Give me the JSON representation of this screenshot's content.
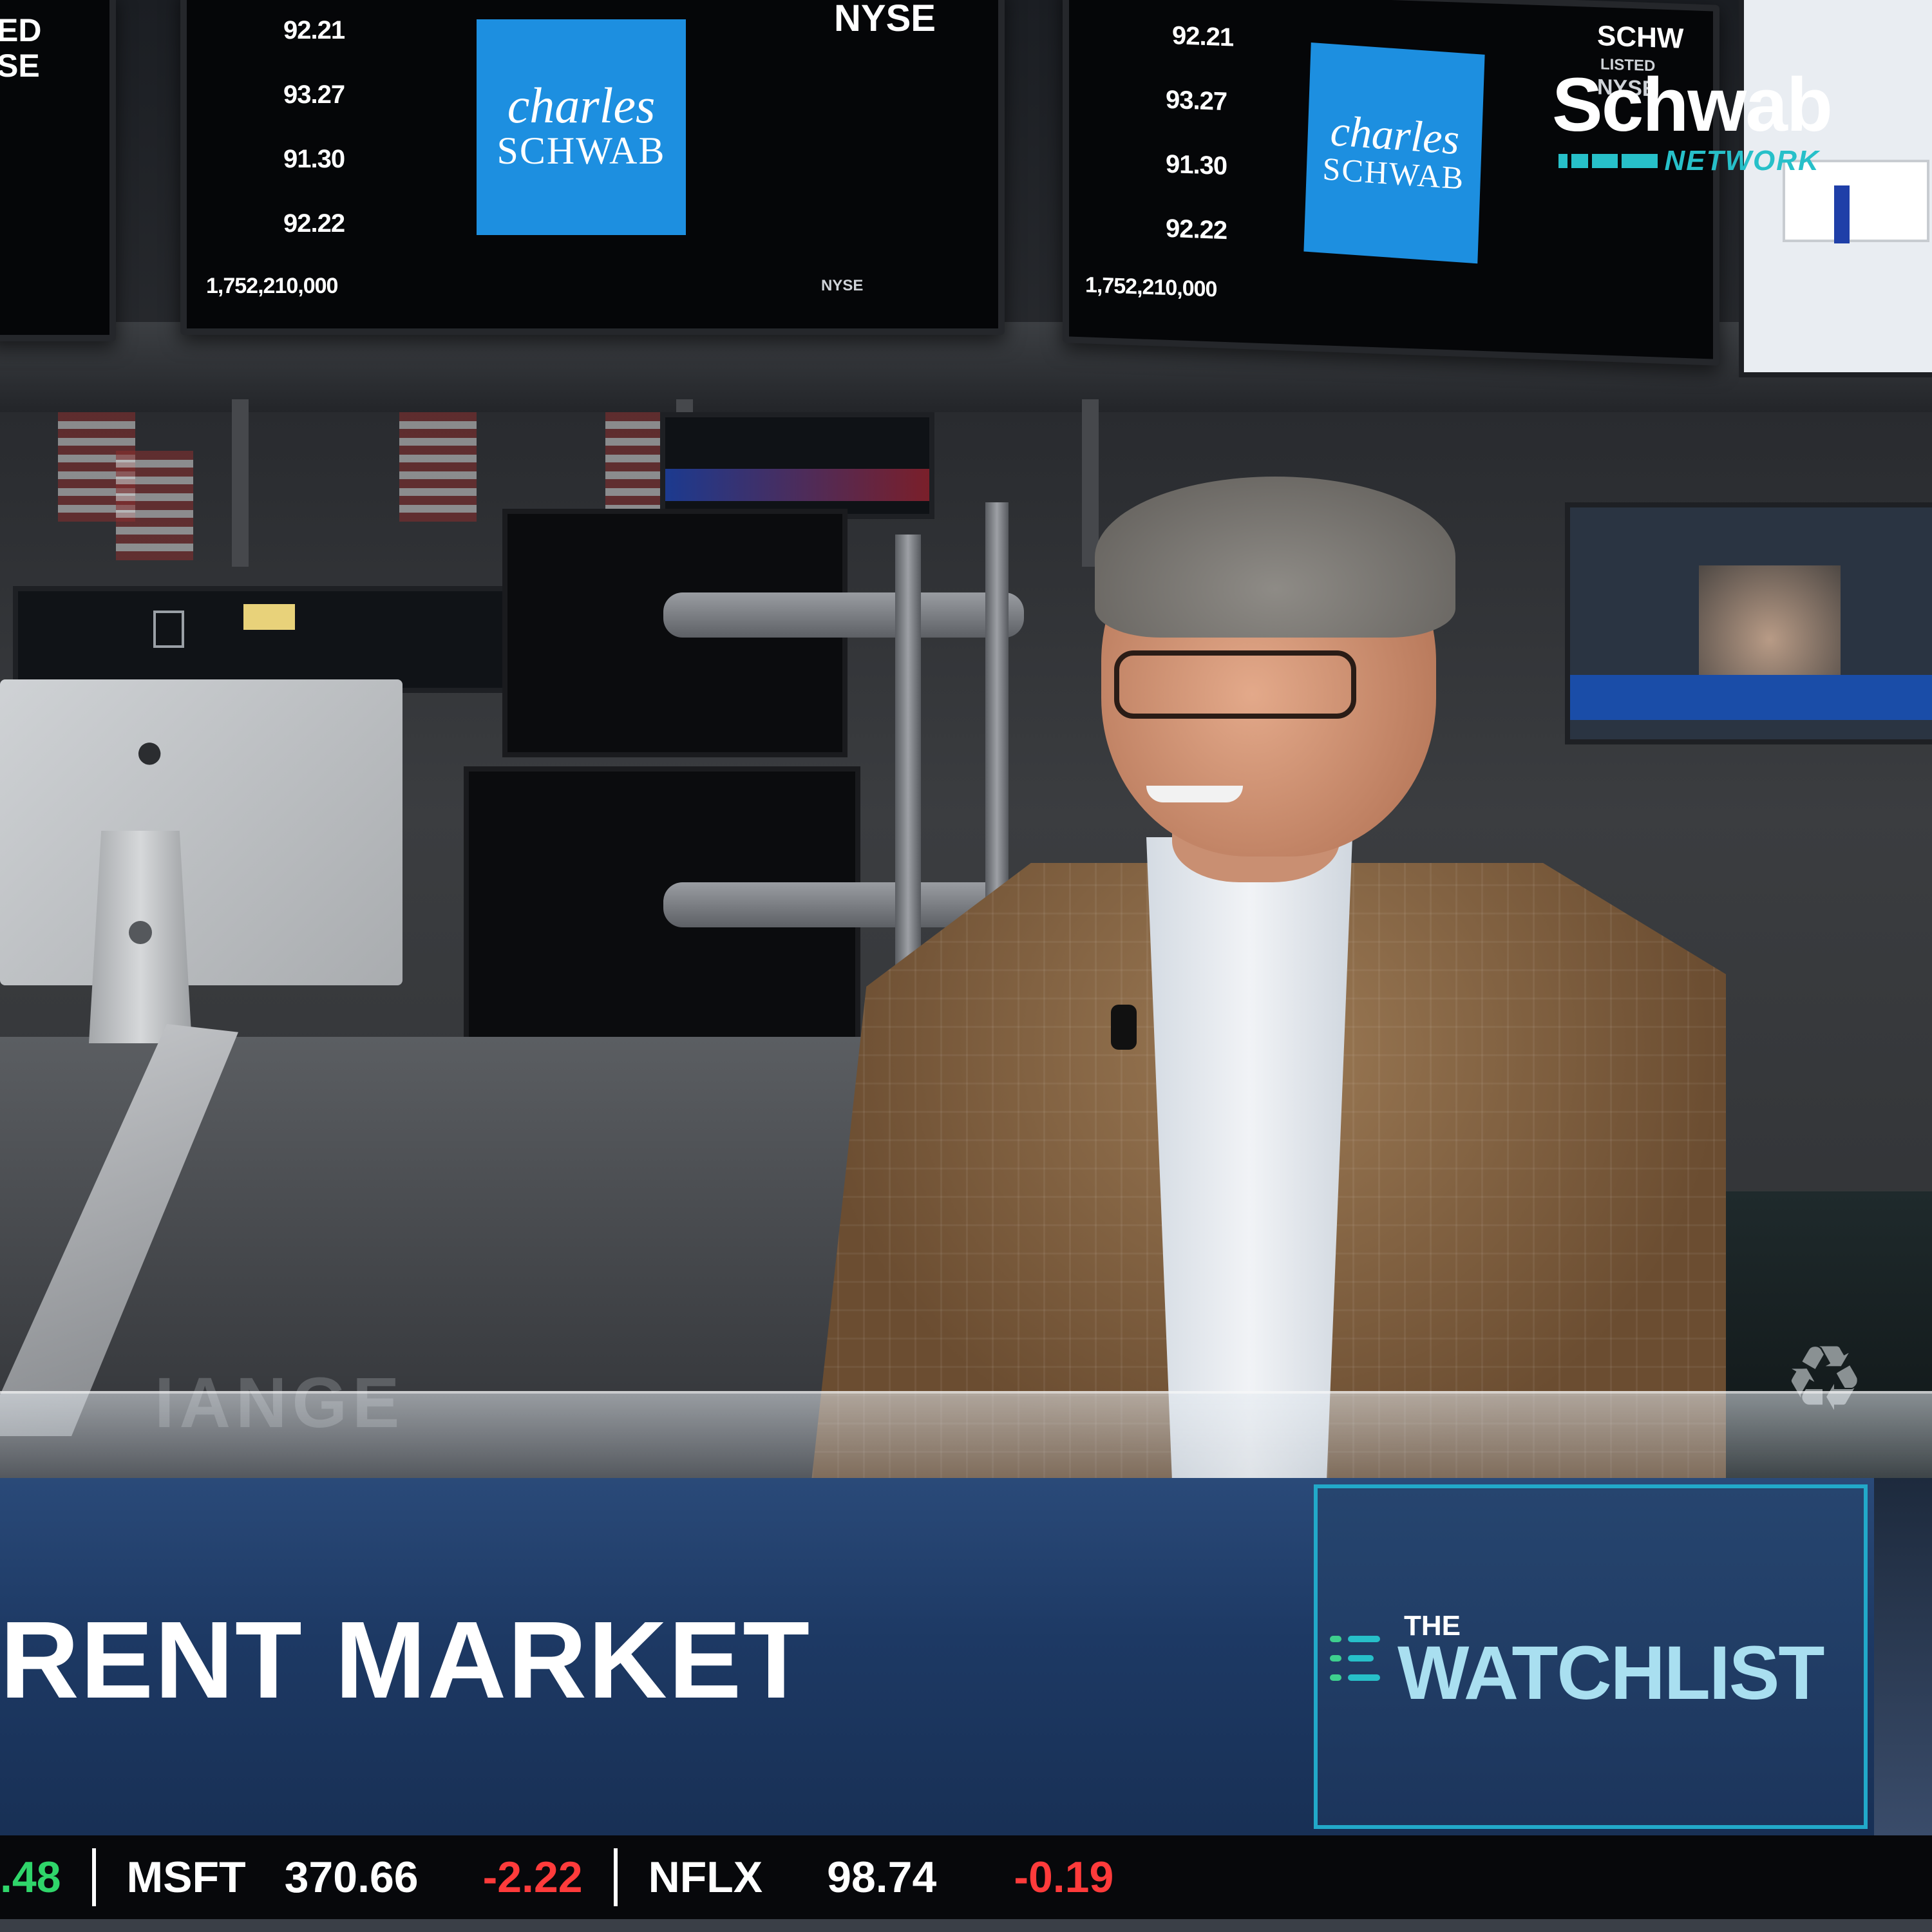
{
  "logo": {
    "brand": "Schwab",
    "sub": "NETWORK"
  },
  "monitors": {
    "left_partial_text": "ED\nSE",
    "quotes": [
      "92.21",
      "93.27",
      "91.30",
      "92.22"
    ],
    "shares": "1,752,210,000",
    "logo_line1": "charles",
    "logo_line2": "SCHWAB",
    "exchange": "NYSE",
    "exchange_small": "NYSE",
    "right_ticker": "SCHW",
    "right_listed": "LISTED",
    "right_exchange": "NYSE"
  },
  "lower_third": {
    "headline": "RENT MARKET",
    "show_the": "THE",
    "show_title": "WATCHLIST",
    "accent_color": "#22a9c9"
  },
  "ticker": {
    "items": [
      {
        "kind": "change",
        "text": ".48",
        "direction": "up"
      },
      {
        "kind": "symbol",
        "text": "MSFT"
      },
      {
        "kind": "price",
        "text": "370.66"
      },
      {
        "kind": "change",
        "text": "-2.22",
        "direction": "down"
      },
      {
        "kind": "symbol",
        "text": "NFLX"
      },
      {
        "kind": "price",
        "text": "98.74"
      },
      {
        "kind": "change",
        "text": "-0.19",
        "direction": "down"
      }
    ]
  },
  "icons": {
    "apple": "apple-logo-icon",
    "recycle": "recycle-icon",
    "network_bars": "signal-bars-icon"
  }
}
